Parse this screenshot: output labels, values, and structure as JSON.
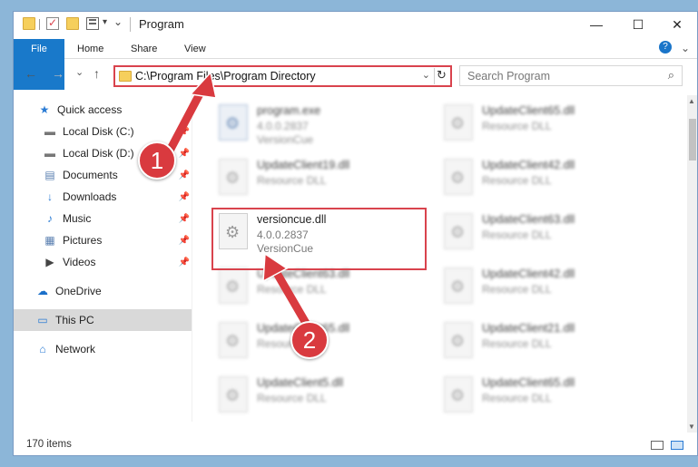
{
  "window": {
    "title": "Program",
    "minimize": "—",
    "maximize": "☐",
    "close": "✕"
  },
  "ribbon": {
    "tabs": [
      "File",
      "Home",
      "Share",
      "View"
    ],
    "help": "?",
    "expand": "⌄"
  },
  "address": {
    "path": "C:\\Program Files\\Program Directory",
    "refresh": "↻",
    "dropdown": "⌄"
  },
  "search": {
    "placeholder": "Search Program",
    "icon": "⌕"
  },
  "nav": {
    "back": "←",
    "forward": "→",
    "recent": "⌄",
    "up": "↑",
    "items": [
      {
        "label": "Quick access",
        "icon": "★"
      },
      {
        "label": "Local Disk (C:)",
        "icon": "▬",
        "pin": "📌"
      },
      {
        "label": "Local Disk (D:)",
        "icon": "▬",
        "pin": "📌"
      },
      {
        "label": "Documents",
        "icon": "▤",
        "pin": "📌"
      },
      {
        "label": "Downloads",
        "icon": "↓",
        "pin": "📌"
      },
      {
        "label": "Music",
        "icon": "♪",
        "pin": "📌"
      },
      {
        "label": "Pictures",
        "icon": "▦",
        "pin": "📌"
      },
      {
        "label": "Videos",
        "icon": "▶",
        "pin": "📌"
      },
      {
        "label": "OneDrive",
        "icon": "☁"
      },
      {
        "label": "This PC",
        "icon": "▭"
      },
      {
        "label": "Network",
        "icon": "⌂"
      }
    ]
  },
  "files": {
    "left": [
      {
        "name": "program.exe",
        "line1": "4.0.0.2837",
        "line2": "VersionCue"
      },
      {
        "name": "UpdateClient19.dll",
        "line1": "Resource DLL",
        "line2": ""
      },
      {
        "name": "versioncue.dll",
        "line1": "4.0.0.2837",
        "line2": "VersionCue"
      },
      {
        "name": "UpdateClient63.dll",
        "line1": "Resource DLL",
        "line2": ""
      },
      {
        "name": "UpdateClient65.dll",
        "line1": "Resource DLL",
        "line2": ""
      },
      {
        "name": "UpdateClient5.dll",
        "line1": "Resource DLL",
        "line2": ""
      }
    ],
    "right": [
      {
        "name": "UpdateClient65.dll",
        "line1": "Resource DLL",
        "line2": ""
      },
      {
        "name": "UpdateClient42.dll",
        "line1": "Resource DLL",
        "line2": ""
      },
      {
        "name": "UpdateClient63.dll",
        "line1": "Resource DLL",
        "line2": ""
      },
      {
        "name": "UpdateClient42.dll",
        "line1": "Resource DLL",
        "line2": ""
      },
      {
        "name": "UpdateClient21.dll",
        "line1": "Resource DLL",
        "line2": ""
      },
      {
        "name": "UpdateClient65.dll",
        "line1": "Resource DLL",
        "line2": ""
      }
    ]
  },
  "status": {
    "count": "170 items"
  },
  "annotations": {
    "step1": "1",
    "step2": "2",
    "color": "#d93a3f"
  }
}
